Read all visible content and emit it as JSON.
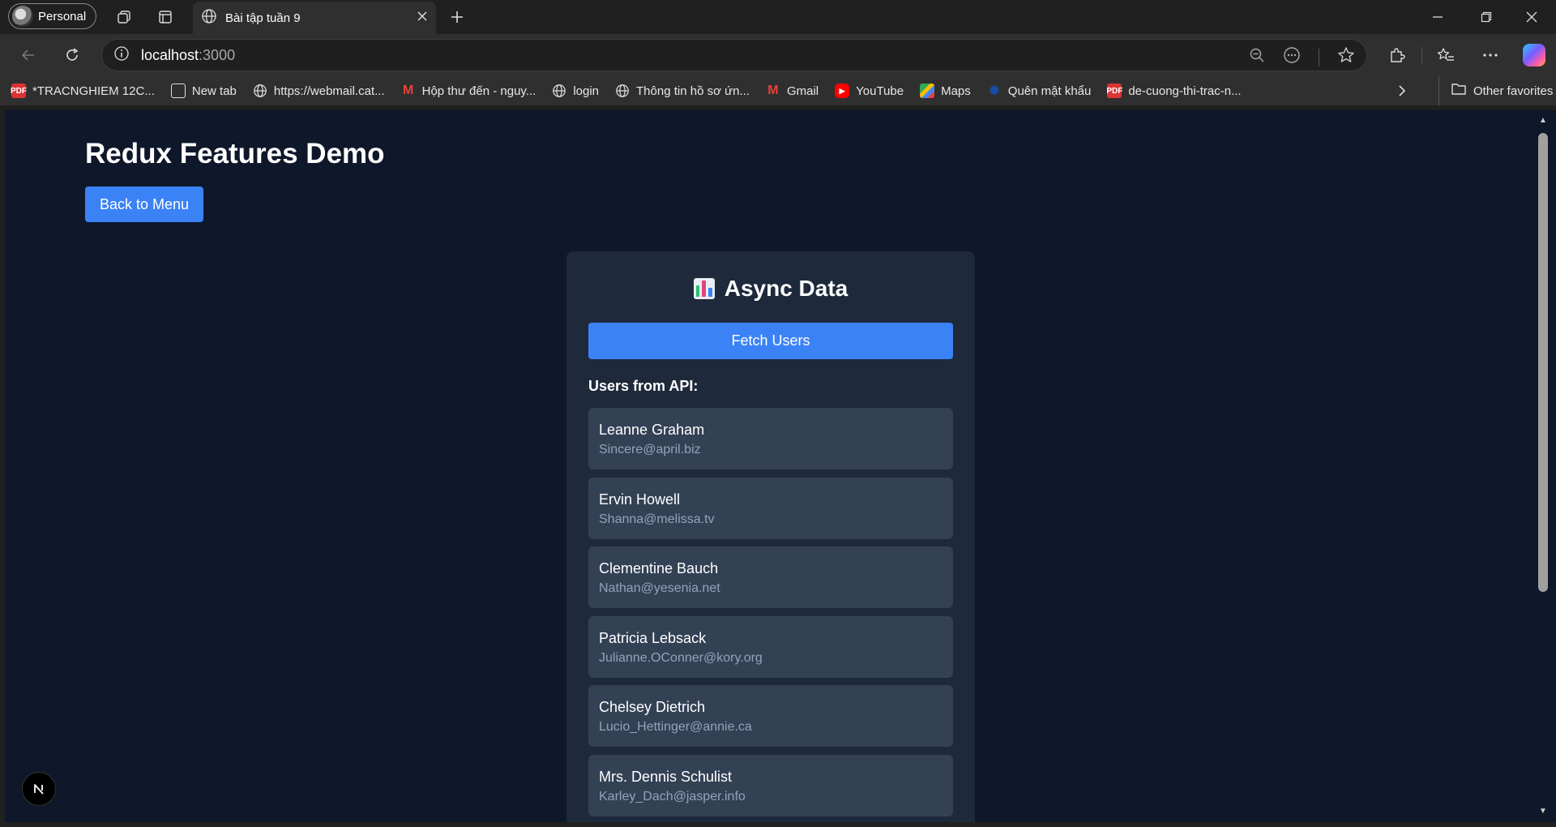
{
  "browser": {
    "profile_label": "Personal",
    "tab_title": "Bài tập tuần 9",
    "url_host": "localhost",
    "url_port": ":3000"
  },
  "bookmarks": {
    "items": [
      {
        "label": "*TRACNGHIEM 12C...",
        "icon": "pdf-icon"
      },
      {
        "label": "New tab",
        "icon": "new-tab-icon"
      },
      {
        "label": "https://webmail.cat...",
        "icon": "globe-icon"
      },
      {
        "label": "Hộp thư đến - nguy...",
        "icon": "gmail-icon"
      },
      {
        "label": "login",
        "icon": "globe-icon"
      },
      {
        "label": "Thông tin hồ sơ ứn...",
        "icon": "globe-icon"
      },
      {
        "label": "Gmail",
        "icon": "gmail-icon"
      },
      {
        "label": "YouTube",
        "icon": "youtube-icon"
      },
      {
        "label": "Maps",
        "icon": "maps-icon"
      },
      {
        "label": "Quên mật khẩu",
        "icon": "gear-icon"
      },
      {
        "label": "de-cuong-thi-trac-n...",
        "icon": "pdf-icon"
      }
    ],
    "other_favorites": "Other favorites"
  },
  "page": {
    "title": "Redux Features Demo",
    "back_button": "Back to Menu"
  },
  "card": {
    "title": "Async Data",
    "fetch_button": "Fetch Users",
    "users_heading": "Users from API:",
    "users": [
      {
        "name": "Leanne Graham",
        "email": "Sincere@april.biz"
      },
      {
        "name": "Ervin Howell",
        "email": "Shanna@melissa.tv"
      },
      {
        "name": "Clementine Bauch",
        "email": "Nathan@yesenia.net"
      },
      {
        "name": "Patricia Lebsack",
        "email": "Julianne.OConner@kory.org"
      },
      {
        "name": "Chelsey Dietrich",
        "email": "Lucio_Hettinger@annie.ca"
      },
      {
        "name": "Mrs. Dennis Schulist",
        "email": "Karley_Dach@jasper.info"
      }
    ]
  },
  "colors": {
    "page_bg": "#0f172a",
    "card_bg": "#1e293b",
    "item_bg": "#334155",
    "accent": "#3b82f6",
    "email_text": "#94a3b8"
  }
}
